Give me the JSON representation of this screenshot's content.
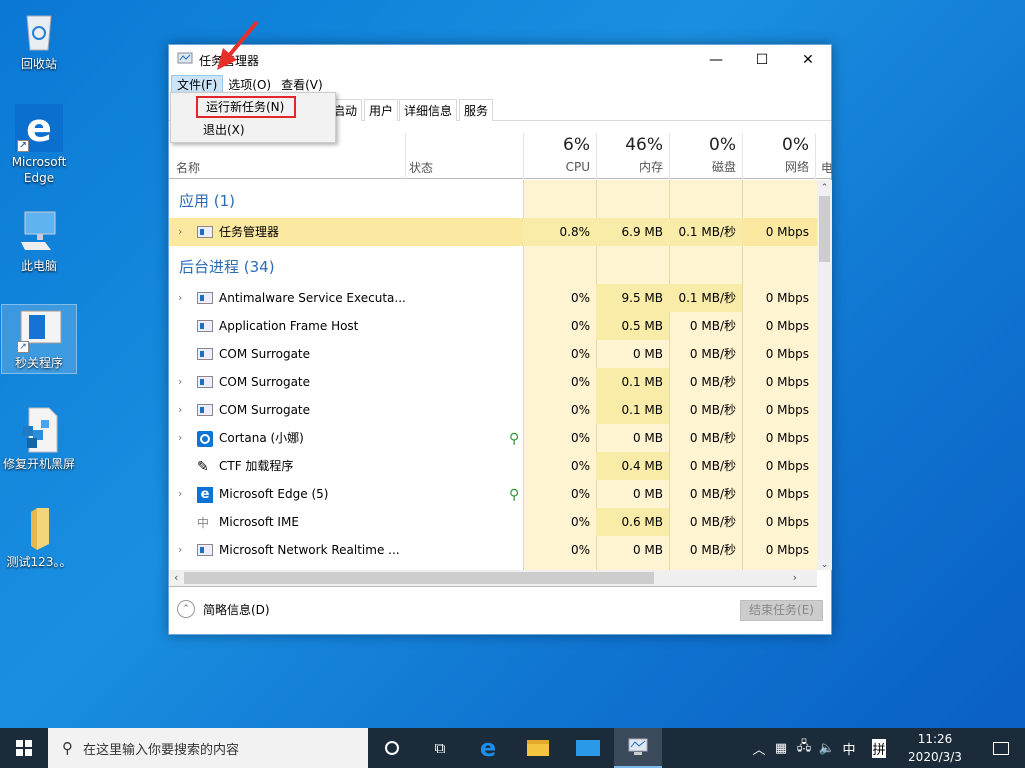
{
  "desktop": {
    "icons": [
      {
        "label": "回收站",
        "icon": "recycle-bin-icon"
      },
      {
        "label": "Microsoft Edge",
        "icon": "edge-icon"
      },
      {
        "label": "此电脑",
        "icon": "computer-icon"
      },
      {
        "label": "秒关程序",
        "icon": "app-shortcut-icon"
      },
      {
        "label": "修复开机黑屏",
        "icon": "registry-icon"
      },
      {
        "label": "测试123。。",
        "icon": "folder-icon"
      }
    ]
  },
  "window": {
    "title": "任务管理器",
    "controls": {
      "minimize": "—",
      "maximize": "☐",
      "close": "✕"
    },
    "menu": [
      "文件(F)",
      "选项(O)",
      "查看(V)"
    ],
    "file_menu": [
      "运行新任务(N)",
      "退出(X)"
    ],
    "tabs": [
      "启动",
      "用户",
      "详细信息",
      "服务"
    ],
    "columns": {
      "name": "名称",
      "status": "状态",
      "cpu": {
        "pct": "6%",
        "label": "CPU"
      },
      "memory": {
        "pct": "46%",
        "label": "内存"
      },
      "disk": {
        "pct": "0%",
        "label": "磁盘"
      },
      "network": {
        "pct": "0%",
        "label": "网络"
      },
      "power": "电"
    },
    "groups": {
      "apps": "应用 (1)",
      "background": "后台进程 (34)"
    },
    "apps": [
      {
        "name": "任务管理器",
        "cpu": "0.8%",
        "mem": "6.9 MB",
        "disk": "0.1 MB/秒",
        "net": "0 Mbps",
        "expand": true
      }
    ],
    "background": [
      {
        "name": "Antimalware Service Executa...",
        "cpu": "0%",
        "mem": "9.5 MB",
        "disk": "0.1 MB/秒",
        "net": "0 Mbps",
        "expand": true,
        "leaf": false
      },
      {
        "name": "Application Frame Host",
        "cpu": "0%",
        "mem": "0.5 MB",
        "disk": "0 MB/秒",
        "net": "0 Mbps",
        "expand": false,
        "leaf": false
      },
      {
        "name": "COM Surrogate",
        "cpu": "0%",
        "mem": "0 MB",
        "disk": "0 MB/秒",
        "net": "0 Mbps",
        "expand": false,
        "leaf": false
      },
      {
        "name": "COM Surrogate",
        "cpu": "0%",
        "mem": "0.1 MB",
        "disk": "0 MB/秒",
        "net": "0 Mbps",
        "expand": true,
        "leaf": false
      },
      {
        "name": "COM Surrogate",
        "cpu": "0%",
        "mem": "0.1 MB",
        "disk": "0 MB/秒",
        "net": "0 Mbps",
        "expand": true,
        "leaf": false
      },
      {
        "name": "Cortana (小娜)",
        "cpu": "0%",
        "mem": "0 MB",
        "disk": "0 MB/秒",
        "net": "0 Mbps",
        "expand": true,
        "leaf": true
      },
      {
        "name": "CTF 加载程序",
        "cpu": "0%",
        "mem": "0.4 MB",
        "disk": "0 MB/秒",
        "net": "0 Mbps",
        "expand": false,
        "leaf": false
      },
      {
        "name": "Microsoft Edge (5)",
        "cpu": "0%",
        "mem": "0 MB",
        "disk": "0 MB/秒",
        "net": "0 Mbps",
        "expand": true,
        "leaf": true
      },
      {
        "name": "Microsoft IME",
        "cpu": "0%",
        "mem": "0.6 MB",
        "disk": "0 MB/秒",
        "net": "0 Mbps",
        "expand": false,
        "leaf": false
      },
      {
        "name": "Microsoft Network Realtime ...",
        "cpu": "0%",
        "mem": "0 MB",
        "disk": "0 MB/秒",
        "net": "0 Mbps",
        "expand": true,
        "leaf": false
      }
    ],
    "footer": {
      "fewer_details": "简略信息(D)",
      "end_task": "结束任务(E)"
    }
  },
  "taskbar": {
    "search_placeholder": "在这里输入你要搜索的内容",
    "ime_mode": "中",
    "ime_pinyin": "拼",
    "time": "11:26",
    "date": "2020/3/3"
  }
}
